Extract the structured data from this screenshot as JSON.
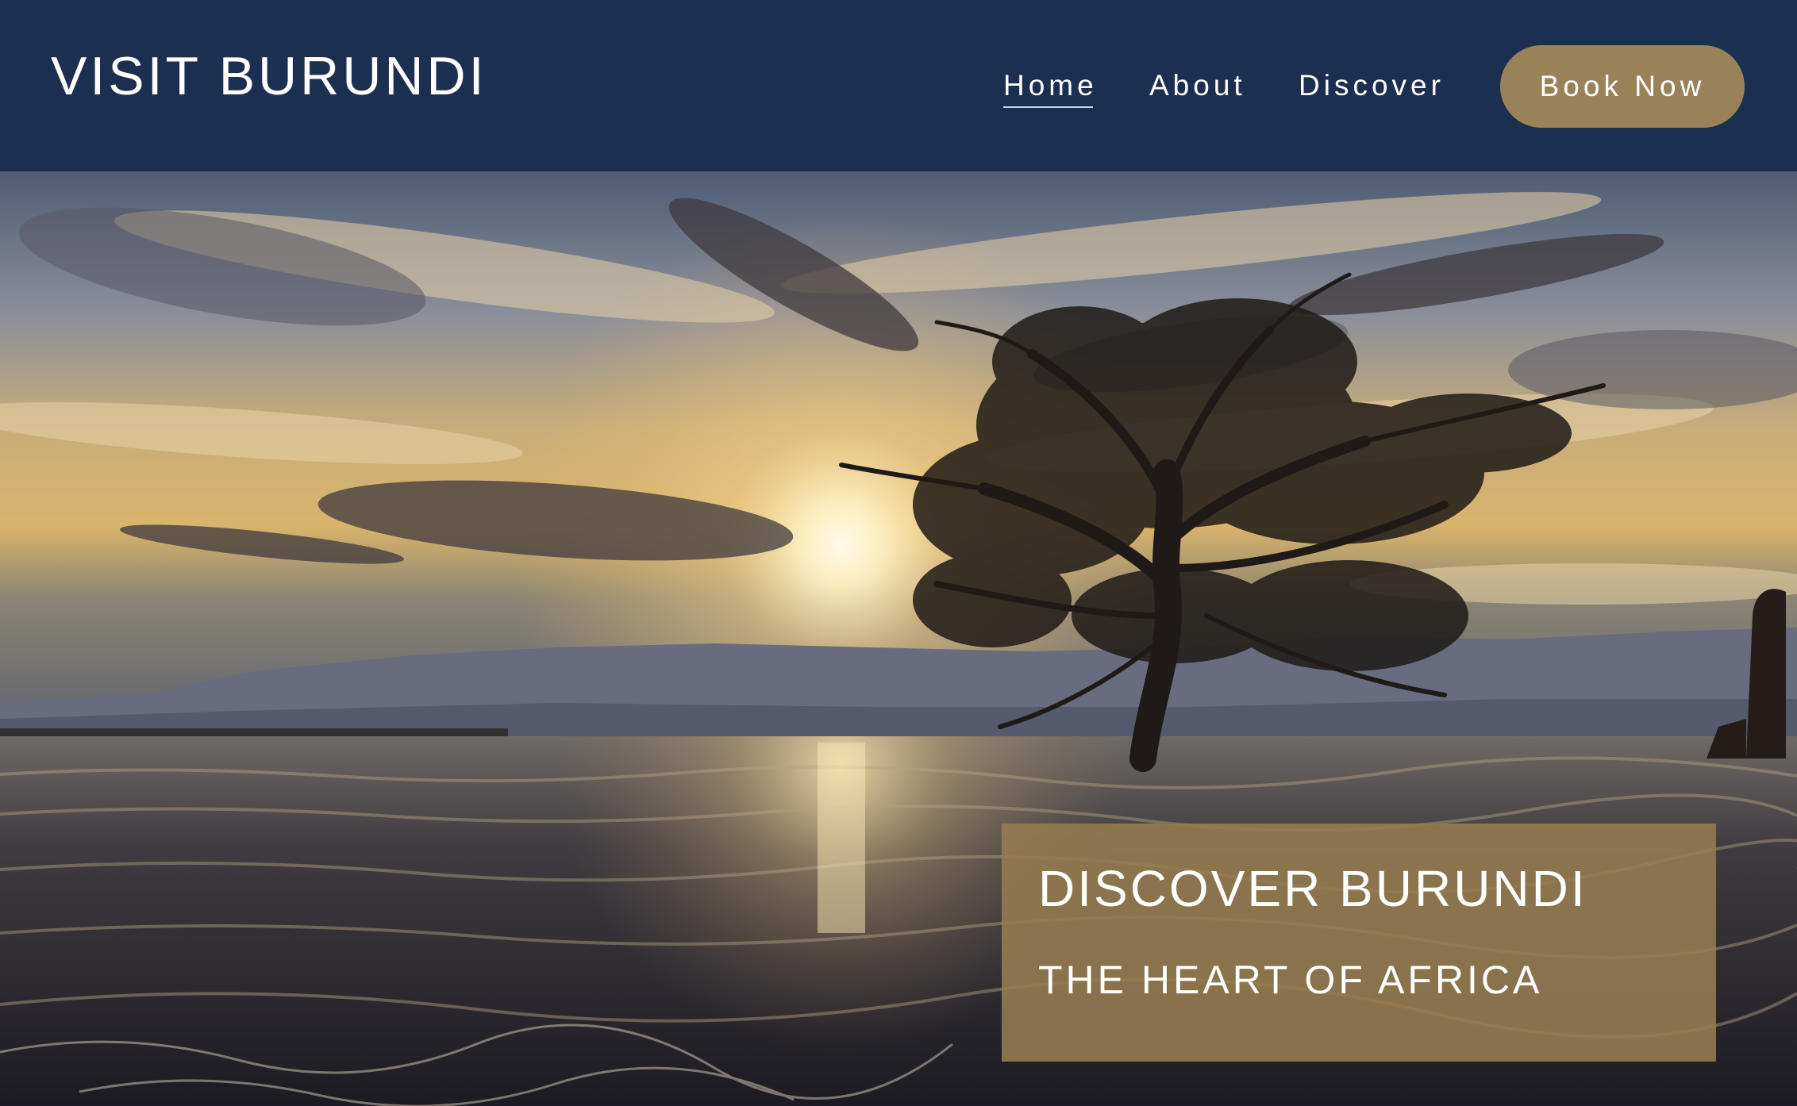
{
  "header": {
    "brand": "VISIT BURUNDI",
    "nav": [
      {
        "label": "Home",
        "active": true
      },
      {
        "label": "About",
        "active": false
      },
      {
        "label": "Discover",
        "active": false
      }
    ],
    "cta_label": "Book Now"
  },
  "hero": {
    "image": "lake-sunset-tree",
    "callout_title": "DISCOVER BURUNDI",
    "callout_subtitle": "THE HEART OF AFRICA"
  },
  "colors": {
    "header_bg": "#1b3050",
    "accent": "#9a8258",
    "text": "#ffffff"
  }
}
